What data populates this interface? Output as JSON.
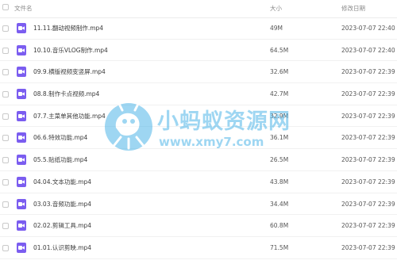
{
  "columns": {
    "name": "文件名",
    "size": "大小",
    "date": "修改日期"
  },
  "files": [
    {
      "name": "11.11.翻动视频制作.mp4",
      "size": "49M",
      "date": "2023-07-07 22:40",
      "icon": "video-file-icon"
    },
    {
      "name": "10.10.音乐VLOG制作.mp4",
      "size": "64.5M",
      "date": "2023-07-07 22:40",
      "icon": "video-file-icon"
    },
    {
      "name": "09.9.横版视频变竖屏.mp4",
      "size": "32.6M",
      "date": "2023-07-07 22:39",
      "icon": "video-file-icon"
    },
    {
      "name": "08.8.制作卡点视频.mp4",
      "size": "42.7M",
      "date": "2023-07-07 22:39",
      "icon": "video-file-icon"
    },
    {
      "name": "07.7.主菜单其他功能.mp4",
      "size": "32.9M",
      "date": "2023-07-07 22:39",
      "icon": "video-file-icon"
    },
    {
      "name": "06.6.特效功能.mp4",
      "size": "36.1M",
      "date": "2023-07-07 22:39",
      "icon": "video-file-icon"
    },
    {
      "name": "05.5.贴纸功能.mp4",
      "size": "26.5M",
      "date": "2023-07-07 22:39",
      "icon": "video-file-icon"
    },
    {
      "name": "04.04.文本功能.mp4",
      "size": "43.8M",
      "date": "2023-07-07 22:39",
      "icon": "video-file-icon"
    },
    {
      "name": "03.03.音频功能.mp4",
      "size": "34.4M",
      "date": "2023-07-07 22:39",
      "icon": "video-file-icon"
    },
    {
      "name": "02.02.剪辑工具.mp4",
      "size": "60.8M",
      "date": "2023-07-07 22:39",
      "icon": "video-file-icon"
    },
    {
      "name": "01.01.认识剪映.mp4",
      "size": "71.5M",
      "date": "2023-07-07 22:39",
      "icon": "video-file-icon"
    }
  ],
  "watermark": {
    "text": "小蚂蚁资源网",
    "url": "www.xmy7.com"
  },
  "colors": {
    "icon": "#7b5df0",
    "watermark": "#4fb6e8"
  }
}
